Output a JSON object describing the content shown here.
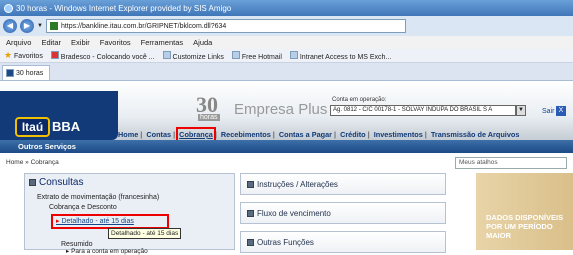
{
  "window": {
    "title": "30 horas - Windows Internet Explorer provided by SIS Amigo"
  },
  "address": {
    "url": "https://bankline.itau.com.br/GRIPNET/bklcom.dll?634"
  },
  "menu": [
    "Arquivo",
    "Editar",
    "Exibir",
    "Favoritos",
    "Ferramentas",
    "Ajuda"
  ],
  "favorites": {
    "label": "Favoritos",
    "items": [
      "Bradesco - Colocando você ...",
      "Customize Links",
      "Free Hotmail",
      "Intranet Access to MS Exch..."
    ]
  },
  "tab": {
    "label": "30 horas"
  },
  "header": {
    "logo_itau": "Itaú",
    "logo_bba": "BBA",
    "num": "30",
    "horas": "horas",
    "brand": "Empresa Plus",
    "conta_label": "Conta em operação:",
    "conta_value": "Ag. 0812 - C/C 00178-1 - SOLVAY INDUPA DO BRASIL S A",
    "sair": "Sair",
    "sair_x": "X"
  },
  "nav": [
    "Home",
    "Contas",
    "Cobrança",
    "Recebimentos",
    "Contas a Pagar",
    "Crédito",
    "Investimentos",
    "Transmissão de Arquivos"
  ],
  "outros": "Outros Serviços",
  "breadcrumb": "Home » Cobrança",
  "search": {
    "placeholder": "Meus atalhos"
  },
  "consultas": {
    "title": "Consultas",
    "extrato": "Extrato de movimentação (francesinha)",
    "cobranca": "Cobrança e Desconto",
    "detalhado": "Detalhado - até 15 dias",
    "tooltip": "Detalhado - até 15 dias",
    "resumido": "Resumido",
    "resumido_sub": "Para a conta em operação"
  },
  "boxes": [
    "Instruções / Alterações",
    "Fluxo de vencimento",
    "Outras Funções"
  ],
  "promo": {
    "line1": "DADOS DISPONÍVEIS",
    "line2": "POR UM PERÍODO",
    "line3": "MAIOR"
  }
}
